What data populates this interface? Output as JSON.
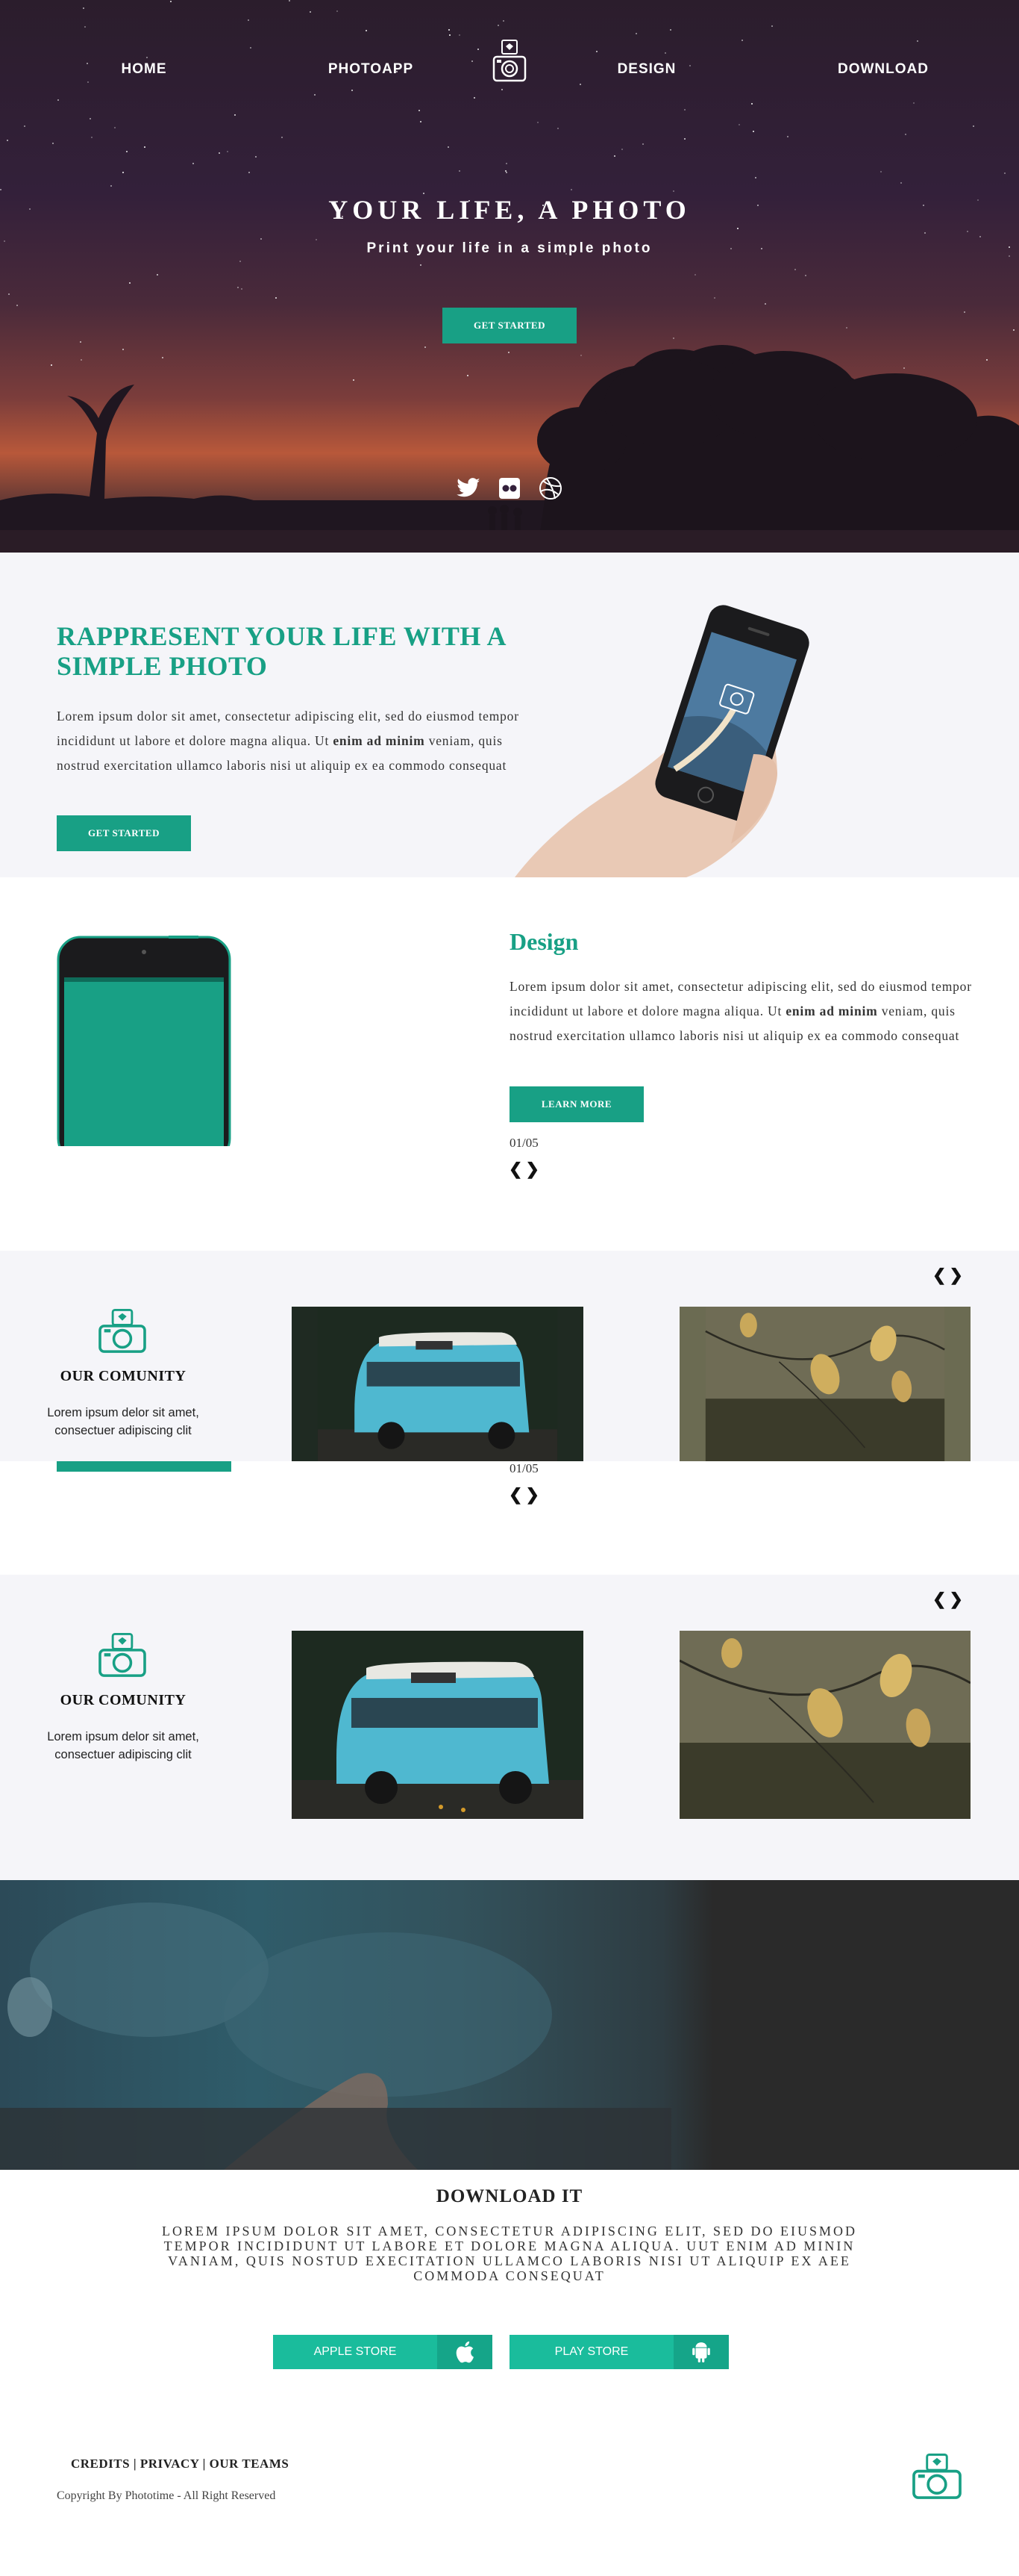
{
  "nav": {
    "home": "HOME",
    "photoapp": "PHOTOAPP",
    "design": "DESIGN",
    "download": "DOWNLOAD"
  },
  "hero": {
    "title": "YOUR LIFE, A PHOTO",
    "subtitle": "Print your life in a simple photo",
    "button": "GET STARTED",
    "social_icons": [
      "twitter-icon",
      "flickr-icon",
      "dribbble-icon"
    ]
  },
  "represent": {
    "title": "RAPPRESENT YOUR LIFE WITH A SIMPLE PHOTO",
    "text_before": "Lorem ipsum dolor sit amet, consectetur adipiscing elit, sed do eiusmod tempor incididunt ut labore et dolore magna aliqua. Ut ",
    "text_bold": "enim ad minim",
    "text_after": " veniam, quis nostrud exercitation ullamco laboris nisi ut aliquip ex ea commodo consequat",
    "button": "GET STARTED"
  },
  "design": {
    "title": "Design",
    "text_before": "Lorem ipsum dolor sit amet, consectetur adipiscing elit, sed do eiusmod tempor incididunt ut labore et dolore magna aliqua. Ut ",
    "text_bold": "enim ad minim",
    "text_after": " veniam, quis nostrud exercitation ullamco laboris nisi ut aliquip ex ea commodo consequat",
    "button": "LEARN MORE",
    "counter": "01/05",
    "counter_dup": "01/05"
  },
  "community": {
    "title": "OUR COMUNITY",
    "text": "Lorem ipsum delor sit amet, consectuer adipiscing clit",
    "title2": "OUR COMUNITY",
    "text2": "Lorem ipsum delor sit amet, consectuer adipiscing clit"
  },
  "download": {
    "title": "DOWNLOAD IT",
    "text": "Lorem ipsum dolor sit amet, consectetur adipiscing elit, sed do eiusmod tempor incididunt ut labore et dolore magna aliqua. Uut enim ad minin vaniam, quis nostud execitation ullamco laboris nisi ut aliquip ex aee commoda consequat",
    "apple": "APPLE STORE",
    "play": "PLAY STORE"
  },
  "footer": {
    "credits": "CREDITS",
    "privacy": "PRIVACY",
    "teams": "OUR TEAMS",
    "separator": "|",
    "copyright": "Copyright By Phototime - All Right Reserved"
  },
  "colors": {
    "accent": "#18a085",
    "store_button": "#1abc9c"
  }
}
